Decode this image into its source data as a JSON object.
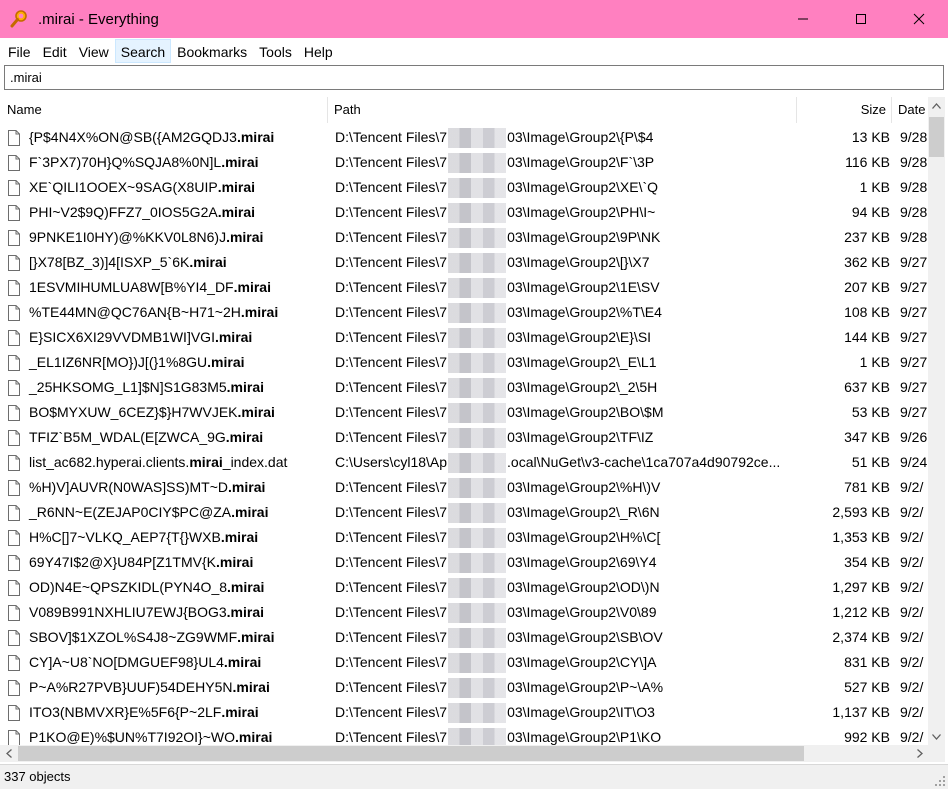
{
  "window": {
    "title": ".mirai - Everything",
    "accent_color": "#ff80c0",
    "icon": "magnifier-icon"
  },
  "menu": [
    "File",
    "Edit",
    "View",
    "Search",
    "Bookmarks",
    "Tools",
    "Help"
  ],
  "active_menu": "Search",
  "search": {
    "value": ".mirai"
  },
  "columns": {
    "name": "Name",
    "path": "Path",
    "size": "Size",
    "date": "Date"
  },
  "rows": [
    {
      "name_pre": "{P$4N4X%ON@SB({AM2GQDJ3",
      "name_hl": ".mirai",
      "name_post": "",
      "path_pre": "D:\\Tencent Files\\7",
      "path_post": "03\\Image\\Group2\\{P\\$4",
      "size": "13 KB",
      "date": "9/28"
    },
    {
      "name_pre": "F`3PX7)70H}Q%SQJA8%0N]L",
      "name_hl": ".mirai",
      "name_post": "",
      "path_pre": "D:\\Tencent Files\\7",
      "path_post": "03\\Image\\Group2\\F`\\3P",
      "size": "116 KB",
      "date": "9/28"
    },
    {
      "name_pre": "XE`QILI1OOEX~9SAG(X8UIP",
      "name_hl": ".mirai",
      "name_post": "",
      "path_pre": "D:\\Tencent Files\\7",
      "path_post": "03\\Image\\Group2\\XE\\`Q",
      "size": "1 KB",
      "date": "9/28"
    },
    {
      "name_pre": "PHI~V2$9Q)FFZ7_0IOS5G2A",
      "name_hl": ".mirai",
      "name_post": "",
      "path_pre": "D:\\Tencent Files\\7",
      "path_post": "03\\Image\\Group2\\PH\\I~",
      "size": "94 KB",
      "date": "9/28"
    },
    {
      "name_pre": "9PNKE1I0HY)@%KKV0L8N6)J",
      "name_hl": ".mirai",
      "name_post": "",
      "path_pre": "D:\\Tencent Files\\7",
      "path_post": "03\\Image\\Group2\\9P\\NK",
      "size": "237 KB",
      "date": "9/28"
    },
    {
      "name_pre": "[}X78[BZ_3)]4[ISXP_5`6K",
      "name_hl": ".mirai",
      "name_post": "",
      "path_pre": "D:\\Tencent Files\\7",
      "path_post": "03\\Image\\Group2\\[}\\X7",
      "size": "362 KB",
      "date": "9/27"
    },
    {
      "name_pre": "1ESVMIHUMLUA8W[B%YI4_DF",
      "name_hl": ".mirai",
      "name_post": "",
      "path_pre": "D:\\Tencent Files\\7",
      "path_post": "03\\Image\\Group2\\1E\\SV",
      "size": "207 KB",
      "date": "9/27"
    },
    {
      "name_pre": "%TE44MN@QC76AN{B~H71~2H",
      "name_hl": ".mirai",
      "name_post": "",
      "path_pre": "D:\\Tencent Files\\7",
      "path_post": "03\\Image\\Group2\\%T\\E4",
      "size": "108 KB",
      "date": "9/27"
    },
    {
      "name_pre": "E}SICX6XI29VVDMB1WI]VGI",
      "name_hl": ".mirai",
      "name_post": "",
      "path_pre": "D:\\Tencent Files\\7",
      "path_post": "03\\Image\\Group2\\E}\\SI",
      "size": "144 KB",
      "date": "9/27"
    },
    {
      "name_pre": "_EL1IZ6NR[MO})J[(}1%8GU",
      "name_hl": ".mirai",
      "name_post": "",
      "path_pre": "D:\\Tencent Files\\7",
      "path_post": "03\\Image\\Group2\\_E\\L1",
      "size": "1 KB",
      "date": "9/27"
    },
    {
      "name_pre": "_25HKSOMG_L1]$N]S1G83M5",
      "name_hl": ".mirai",
      "name_post": "",
      "path_pre": "D:\\Tencent Files\\7",
      "path_post": "03\\Image\\Group2\\_2\\5H",
      "size": "637 KB",
      "date": "9/27"
    },
    {
      "name_pre": "BO$MYXUW_6CEZ}$}H7WVJEK",
      "name_hl": ".mirai",
      "name_post": "",
      "path_pre": "D:\\Tencent Files\\7",
      "path_post": "03\\Image\\Group2\\BO\\$M",
      "size": "53 KB",
      "date": "9/27"
    },
    {
      "name_pre": "TFIZ`B5M_WDAL(E[ZWCA_9G",
      "name_hl": ".mirai",
      "name_post": "",
      "path_pre": "D:\\Tencent Files\\7",
      "path_post": "03\\Image\\Group2\\TF\\IZ",
      "size": "347 KB",
      "date": "9/26"
    },
    {
      "name_pre": "list_ac682.hyperai.clients.",
      "name_hl": "mirai",
      "name_post": "_index.dat",
      "path_pre": "C:\\Users\\cyl18\\Ap",
      "path_post": ".ocal\\NuGet\\v3-cache\\1ca707a4d90792ce...",
      "size": "51 KB",
      "date": "9/24"
    },
    {
      "name_pre": "%H)V]AUVR(N0WAS]SS)MT~D",
      "name_hl": ".mirai",
      "name_post": "",
      "path_pre": "D:\\Tencent Files\\7",
      "path_post": "03\\Image\\Group2\\%H\\)V",
      "size": "781 KB",
      "date": "9/2/"
    },
    {
      "name_pre": "_R6NN~E(ZEJAP0CIY$PC@ZA",
      "name_hl": ".mirai",
      "name_post": "",
      "path_pre": "D:\\Tencent Files\\7",
      "path_post": "03\\Image\\Group2\\_R\\6N",
      "size": "2,593 KB",
      "date": "9/2/"
    },
    {
      "name_pre": "H%C[]7~VLKQ_AEP7{T{}WXB",
      "name_hl": ".mirai",
      "name_post": "",
      "path_pre": "D:\\Tencent Files\\7",
      "path_post": "03\\Image\\Group2\\H%\\C[",
      "size": "1,353 KB",
      "date": "9/2/"
    },
    {
      "name_pre": "69Y47I$2@X}U84P[Z1TMV{K",
      "name_hl": ".mirai",
      "name_post": "",
      "path_pre": "D:\\Tencent Files\\7",
      "path_post": "03\\Image\\Group2\\69\\Y4",
      "size": "354 KB",
      "date": "9/2/"
    },
    {
      "name_pre": "OD)N4E~QPSZKIDL(PYN4O_8",
      "name_hl": ".mirai",
      "name_post": "",
      "path_pre": "D:\\Tencent Files\\7",
      "path_post": "03\\Image\\Group2\\OD\\)N",
      "size": "1,297 KB",
      "date": "9/2/"
    },
    {
      "name_pre": "V089B991NXHLIU7EWJ{BOG3",
      "name_hl": ".mirai",
      "name_post": "",
      "path_pre": "D:\\Tencent Files\\7",
      "path_post": "03\\Image\\Group2\\V0\\89",
      "size": "1,212 KB",
      "date": "9/2/"
    },
    {
      "name_pre": "SBOV]$1XZOL%S4J8~ZG9WMF",
      "name_hl": ".mirai",
      "name_post": "",
      "path_pre": "D:\\Tencent Files\\7",
      "path_post": "03\\Image\\Group2\\SB\\OV",
      "size": "2,374 KB",
      "date": "9/2/"
    },
    {
      "name_pre": "CY]A~U8`NO[DMGUEF98}UL4",
      "name_hl": ".mirai",
      "name_post": "",
      "path_pre": "D:\\Tencent Files\\7",
      "path_post": "03\\Image\\Group2\\CY\\]A",
      "size": "831 KB",
      "date": "9/2/"
    },
    {
      "name_pre": "P~A%R27PVB}UUF)54DEHY5N",
      "name_hl": ".mirai",
      "name_post": "",
      "path_pre": "D:\\Tencent Files\\7",
      "path_post": "03\\Image\\Group2\\P~\\A%",
      "size": "527 KB",
      "date": "9/2/"
    },
    {
      "name_pre": "ITO3(NBMVXR}E%5F6{P~2LF",
      "name_hl": ".mirai",
      "name_post": "",
      "path_pre": "D:\\Tencent Files\\7",
      "path_post": "03\\Image\\Group2\\IT\\O3",
      "size": "1,137 KB",
      "date": "9/2/"
    },
    {
      "name_pre": "P1KO@E)%$UN%T7I92OI}~WO",
      "name_hl": ".mirai",
      "name_post": "",
      "path_pre": "D:\\Tencent Files\\7",
      "path_post": "03\\Image\\Group2\\P1\\KO",
      "size": "992 KB",
      "date": "9/2/"
    }
  ],
  "status": {
    "text": "337 objects"
  }
}
